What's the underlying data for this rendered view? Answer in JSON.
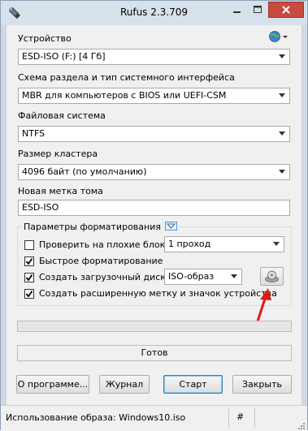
{
  "window": {
    "title": "Rufus 2.3.709",
    "minimize_glyph": "–",
    "maximize_glyph": "□",
    "close_glyph": "✕",
    "close_color": "#c74b3f"
  },
  "device": {
    "label": "Устройство",
    "value": "ESD-ISO (F:) [4 Гб]"
  },
  "partition": {
    "label": "Схема раздела и тип системного интерфейса",
    "value": "MBR для компьютеров с BIOS или UEFI-CSM"
  },
  "filesystem": {
    "label": "Файловая система",
    "value": "NTFS"
  },
  "cluster": {
    "label": "Размер кластера",
    "value": "4096 байт (по умолчанию)"
  },
  "volume": {
    "label": "Новая метка тома",
    "value": "ESD-ISO"
  },
  "format_options": {
    "title": "Параметры форматирования",
    "bad_blocks": {
      "label": "Проверить на плохие блоки",
      "checked": false,
      "passes": "1 проход"
    },
    "quick_format": {
      "label": "Быстрое форматирование",
      "checked": true
    },
    "bootable": {
      "label": "Создать загрузочный диск",
      "checked": true,
      "type": "ISO-образ"
    },
    "extended_label": {
      "label": "Создать расширенную метку и значок устройства",
      "checked": true
    }
  },
  "progress": {
    "value": 0
  },
  "status": {
    "text": "Готов"
  },
  "buttons": {
    "about": "О программе...",
    "log": "Журнал",
    "start": "Старт",
    "close": "Закрыть"
  },
  "statusbar": {
    "text": "Использование образа: Windows10.iso",
    "hash": "#"
  },
  "icons": {
    "app": "usb-drive-icon",
    "language": "globe-icon",
    "iso": "disc-drive-icon",
    "annotation": "red-arrow-icon"
  }
}
